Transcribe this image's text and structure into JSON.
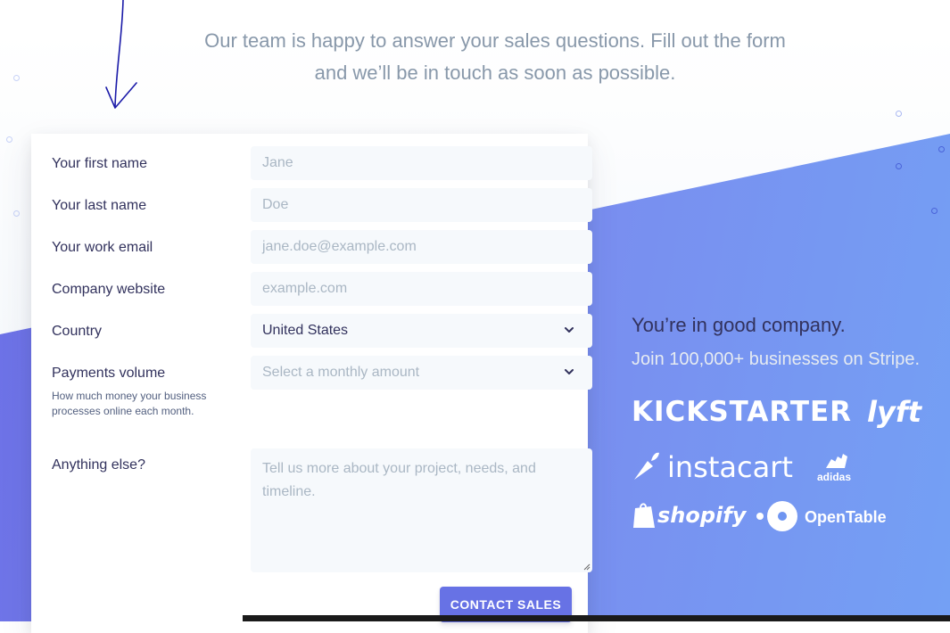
{
  "headline": "Our team is happy to answer your sales questions. Fill out the form and we’ll be in touch as soon as possible.",
  "form": {
    "first_name": {
      "label": "Your first name",
      "placeholder": "Jane"
    },
    "last_name": {
      "label": "Your last name",
      "placeholder": "Doe"
    },
    "email": {
      "label": "Your work email",
      "placeholder": "jane.doe@example.com"
    },
    "website": {
      "label": "Company website",
      "placeholder": "example.com"
    },
    "country": {
      "label": "Country",
      "value": "United States",
      "icon": "chevron-down-icon"
    },
    "volume": {
      "label": "Payments volume",
      "helper": "How much money your business processes online each month.",
      "placeholder": "Select a monthly amount",
      "icon": "chevron-down-icon"
    },
    "notes": {
      "label": "Anything else?",
      "placeholder": "Tell us more about your project, needs, and timeline."
    },
    "submit_label": "CONTACT SALES"
  },
  "company": {
    "title": "You’re in good company.",
    "subtitle": "Join 100,000+ businesses on Stripe.",
    "logos": {
      "kickstarter": "KICKSTARTER",
      "lyft": "lyft",
      "instacart": "instacart",
      "adidas": "adidas",
      "shopify": "shopify",
      "opentable": "OpenTable"
    }
  },
  "colors": {
    "accent": "#6772e5",
    "headline": "#8898aa",
    "text": "#32325d",
    "field_bg": "#f6f9fc",
    "annotation": "#1a1aa8"
  }
}
